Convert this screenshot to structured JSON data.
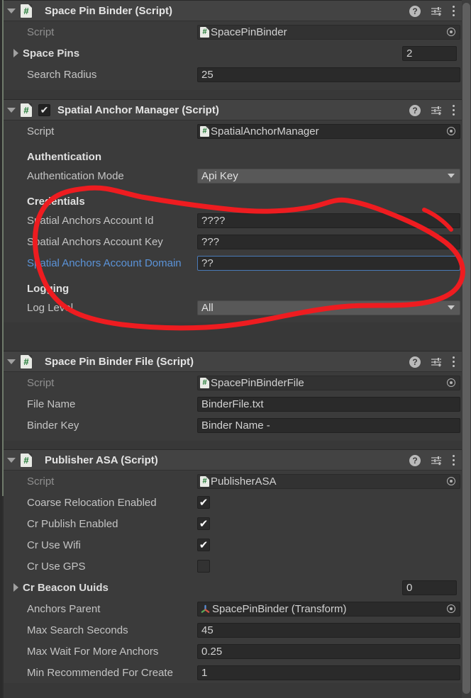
{
  "window": {
    "title": "Unity Inspector"
  },
  "theme": {
    "panel_bg": "#3b3b3b",
    "header_bg": "#434343",
    "field_bg": "#2a2a2a",
    "dropdown_bg": "#585858",
    "accent_focus": "#4a7ab8",
    "label": "#c4c4c4",
    "label_dim": "#8f8f8f",
    "label_link": "#5b93d8",
    "script_icon_green": "#1f7a33",
    "annotation_red": "#ee1c20"
  },
  "header_icons": {
    "help": "?",
    "help_name": "help-icon",
    "preset_name": "preset-icon",
    "menu_name": "kebab-menu-icon"
  },
  "components": [
    {
      "title": "Space Pin Binder (Script)",
      "icon": "script-icon",
      "has_enable_checkbox": false,
      "rows": [
        {
          "kind": "object",
          "label": "Script",
          "value": "SpacePinBinder",
          "readonly": true
        },
        {
          "kind": "foldout_count",
          "label": "Space Pins",
          "value": "2"
        },
        {
          "kind": "text",
          "label": "Search Radius",
          "value": "25"
        }
      ]
    },
    {
      "title": "Spatial Anchor Manager (Script)",
      "icon": "script-icon",
      "has_enable_checkbox": true,
      "enabled": true,
      "rows": [
        {
          "kind": "object",
          "label": "Script",
          "value": "SpatialAnchorManager",
          "readonly": false
        },
        {
          "kind": "spacer"
        },
        {
          "kind": "section",
          "label": "Authentication"
        },
        {
          "kind": "dropdown",
          "label": "Authentication Mode",
          "value": "Api Key"
        },
        {
          "kind": "spacer"
        },
        {
          "kind": "section",
          "label": "Credentials"
        },
        {
          "kind": "text",
          "label": "Spatial Anchors Account Id",
          "value": "????"
        },
        {
          "kind": "text",
          "label": "Spatial Anchors Account Key",
          "value": "???"
        },
        {
          "kind": "text",
          "label": "Spatial Anchors Account Domain",
          "value": "??",
          "focused": true,
          "link": true
        },
        {
          "kind": "spacer"
        },
        {
          "kind": "section",
          "label": "Logging"
        },
        {
          "kind": "dropdown",
          "label": "Log Level",
          "value": "All"
        }
      ]
    },
    {
      "title": "Space Pin Binder File (Script)",
      "icon": "script-icon",
      "has_enable_checkbox": false,
      "rows": [
        {
          "kind": "object",
          "label": "Script",
          "value": "SpacePinBinderFile",
          "readonly": true
        },
        {
          "kind": "text",
          "label": "File Name",
          "value": "BinderFile.txt"
        },
        {
          "kind": "text",
          "label": "Binder Key",
          "value": "Binder Name -"
        }
      ]
    },
    {
      "title": "Publisher ASA (Script)",
      "icon": "script-icon",
      "has_enable_checkbox": false,
      "rows": [
        {
          "kind": "object",
          "label": "Script",
          "value": "PublisherASA",
          "readonly": true
        },
        {
          "kind": "checkbox",
          "label": "Coarse Relocation Enabled",
          "checked": true
        },
        {
          "kind": "checkbox",
          "label": "Cr Publish Enabled",
          "checked": true
        },
        {
          "kind": "checkbox",
          "label": "Cr Use Wifi",
          "checked": true
        },
        {
          "kind": "checkbox",
          "label": "Cr Use GPS",
          "checked": false
        },
        {
          "kind": "foldout_count",
          "label": "Cr Beacon Uuids",
          "value": "0"
        },
        {
          "kind": "object_transform",
          "label": "Anchors Parent",
          "value": "SpacePinBinder (Transform)"
        },
        {
          "kind": "text",
          "label": "Max Search Seconds",
          "value": "45"
        },
        {
          "kind": "text",
          "label": "Max Wait For More Anchors",
          "value": "0.25"
        },
        {
          "kind": "text",
          "label": "Min Recommended For Create",
          "value": "1"
        }
      ]
    }
  ],
  "annotation": {
    "type": "freehand-ellipse",
    "color": "#ee1c20",
    "stroke_width": 7,
    "encircles": "Credentials group (Spatial Anchors Account Id / Key / Domain fields)"
  }
}
